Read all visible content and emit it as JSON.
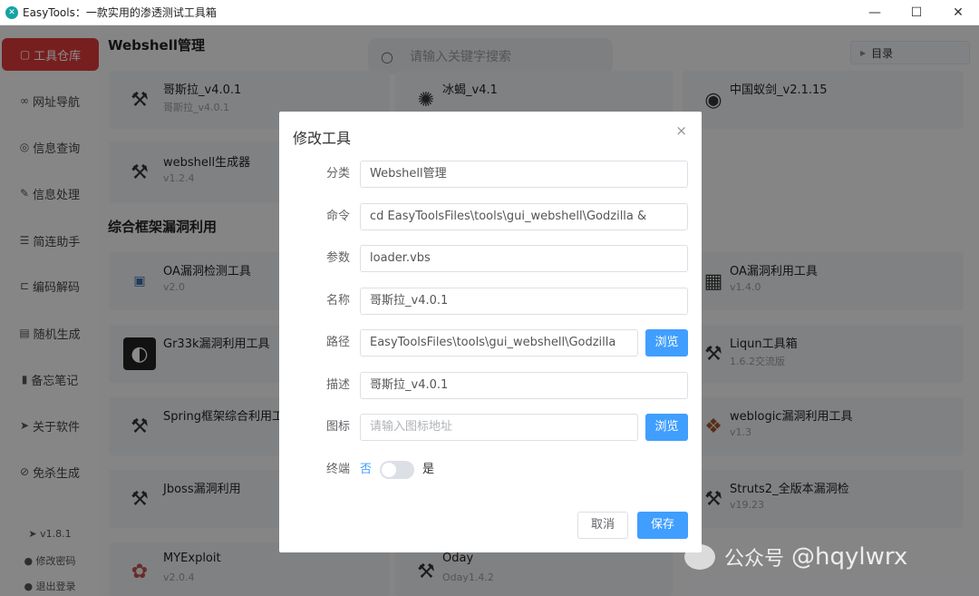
{
  "window": {
    "title": "EasyTools：一款实用的渗透测试工具箱",
    "minimize": "—",
    "maximize": "☐",
    "close": "✕"
  },
  "sidebar": {
    "items": [
      {
        "icon": "box-icon",
        "glyph": "▢",
        "label": "工具仓库",
        "active": true
      },
      {
        "icon": "link-icon",
        "glyph": "∞",
        "label": "网址导航"
      },
      {
        "icon": "search-info-icon",
        "glyph": "◎",
        "label": "信息查询"
      },
      {
        "icon": "edit-icon",
        "glyph": "✎",
        "label": "信息处理"
      },
      {
        "icon": "list-icon",
        "glyph": "☰",
        "label": "简连助手"
      },
      {
        "icon": "code-icon",
        "glyph": "⊏",
        "label": "编码解码"
      },
      {
        "icon": "random-icon",
        "glyph": "▤",
        "label": "随机生成"
      },
      {
        "icon": "note-icon",
        "glyph": "▮",
        "label": "备忘笔记"
      },
      {
        "icon": "send-icon",
        "glyph": "➤",
        "label": "关于软件"
      },
      {
        "icon": "shield-icon",
        "glyph": "⊘",
        "label": "免杀生成"
      }
    ],
    "version": "v1.8.1",
    "change_password": "修改密码",
    "logout": "退出登录"
  },
  "main": {
    "search_placeholder": "请输入关键字搜索",
    "toc_label": "目录",
    "sections": [
      {
        "title": "Webshell管理"
      },
      {
        "title": "综合框架漏洞利用"
      }
    ],
    "cards": [
      {
        "name": "哥斯拉_v4.0.1",
        "version": "哥斯拉_v4.0.1",
        "icon": "tools-icon"
      },
      {
        "name": "冰蝎_v4.1",
        "version": "",
        "icon": "scorpion-icon"
      },
      {
        "name": "中国蚁剑_v2.1.15",
        "version": "",
        "icon": "antsword-icon"
      },
      {
        "name": "webshell生成器",
        "version": "v1.2.4",
        "icon": "tools-icon"
      },
      {
        "name": "OA漏洞检测工具",
        "version": "v2.0",
        "icon": "oa-icon"
      },
      {
        "name": "OA漏洞利用工具",
        "version": "v1.4.0",
        "icon": "oa-exploit-icon"
      },
      {
        "name": "Gr33k漏洞利用工具",
        "version": "",
        "icon": "gr33k-icon"
      },
      {
        "name": "Liqun工具箱",
        "version": "1.6.2交流版",
        "icon": "tools-icon"
      },
      {
        "name": "Spring框架综合利用工",
        "version": "",
        "icon": "tools-icon"
      },
      {
        "name": "weblogic漏洞利用工具",
        "version": "v1.3",
        "icon": "weblogic-icon"
      },
      {
        "name": "Jboss漏洞利用",
        "version": "",
        "icon": "tools-icon"
      },
      {
        "name": "Struts2_全版本漏洞检",
        "version": "v19.23",
        "icon": "tools-icon"
      },
      {
        "name": "MYExploit",
        "version": "v2.0.4",
        "icon": "myexploit-icon"
      },
      {
        "name": "Oday",
        "version": "Oday1.4.2",
        "icon": "tools-icon"
      }
    ]
  },
  "dialog": {
    "title": "修改工具",
    "close": "×",
    "fields": {
      "category": {
        "label": "分类",
        "value": "Webshell管理"
      },
      "command": {
        "label": "命令",
        "value": "cd EasyToolsFiles\\tools\\gui_webshell\\Godzilla &"
      },
      "params": {
        "label": "参数",
        "value": "loader.vbs"
      },
      "name": {
        "label": "名称",
        "value": "哥斯拉_v4.0.1"
      },
      "path": {
        "label": "路径",
        "value": "EasyToolsFiles\\tools\\gui_webshell\\Godzilla"
      },
      "desc": {
        "label": "描述",
        "value": "哥斯拉_v4.0.1"
      },
      "icon": {
        "label": "图标",
        "placeholder": "请输入图标地址"
      }
    },
    "browse": "浏览",
    "terminal": {
      "label": "终端",
      "off": "否",
      "on": "是",
      "enabled": false
    },
    "cancel": "取消",
    "save": "保存"
  },
  "watermark": {
    "a": "公众号",
    "b": "@hqylwrx"
  }
}
